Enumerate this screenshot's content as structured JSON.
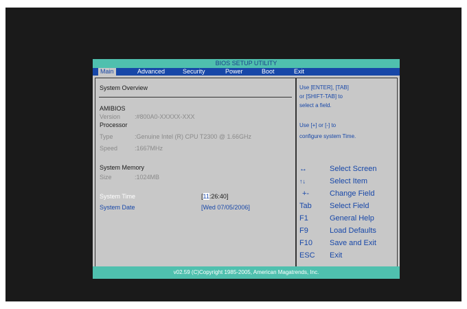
{
  "window": {
    "title": "BIOS SETUP UTILITY"
  },
  "menu": [
    "Main",
    "Advanced",
    "Security",
    "Power",
    "Boot",
    "Exit"
  ],
  "main": {
    "overview_title": "System Overview",
    "amibios": {
      "heading": "AMIBIOS",
      "version_label": "Version",
      "version_value": ":#800A0-XXXXX-XXX"
    },
    "processor": {
      "heading": "Processor",
      "type_label": "Type",
      "type_value": ":Genuine Intel (R) CPU T2300  @ 1.66GHz",
      "speed_label": "Speed",
      "speed_value": ":1667MHz"
    },
    "memory": {
      "heading": "System Memory",
      "size_label": "Size",
      "size_value": ":1024MB"
    },
    "time": {
      "label": "System Time",
      "bracket_open": "[",
      "hour": "11",
      "rest": ":26:40]"
    },
    "date": {
      "label": "System Date",
      "value": "[Wed 07/05/2006]"
    }
  },
  "help": {
    "line1": "Use [ENTER], [TAB]",
    "line2": "or [SHIFT-TAB] to",
    "line3": "select a field.",
    "line4": "Use [+] or [-] to",
    "line5": "configure system Time."
  },
  "keys": [
    {
      "key": "↔",
      "desc": "Select Screen",
      "icon": "left-right-arrows-icon"
    },
    {
      "key": "↑↓",
      "desc": "Select Item",
      "icon": "up-down-arrows-icon"
    },
    {
      "key": "+-",
      "desc": "Change Field"
    },
    {
      "key": "Tab",
      "desc": "Select Field"
    },
    {
      "key": "F1",
      "desc": "General Help"
    },
    {
      "key": "F9",
      "desc": "Load Defaults"
    },
    {
      "key": "F10",
      "desc": "Save and Exit"
    },
    {
      "key": "ESC",
      "desc": "Exit"
    }
  ],
  "footer": {
    "copyright": "v02.59 (C)Copyright 1985-2005, American Magatrends, Inc."
  },
  "colors": {
    "teal": "#4fc0ae",
    "menu_blue": "#1747a8",
    "panel_gray": "#c8c8c8",
    "frame": "#1a1a1a"
  }
}
